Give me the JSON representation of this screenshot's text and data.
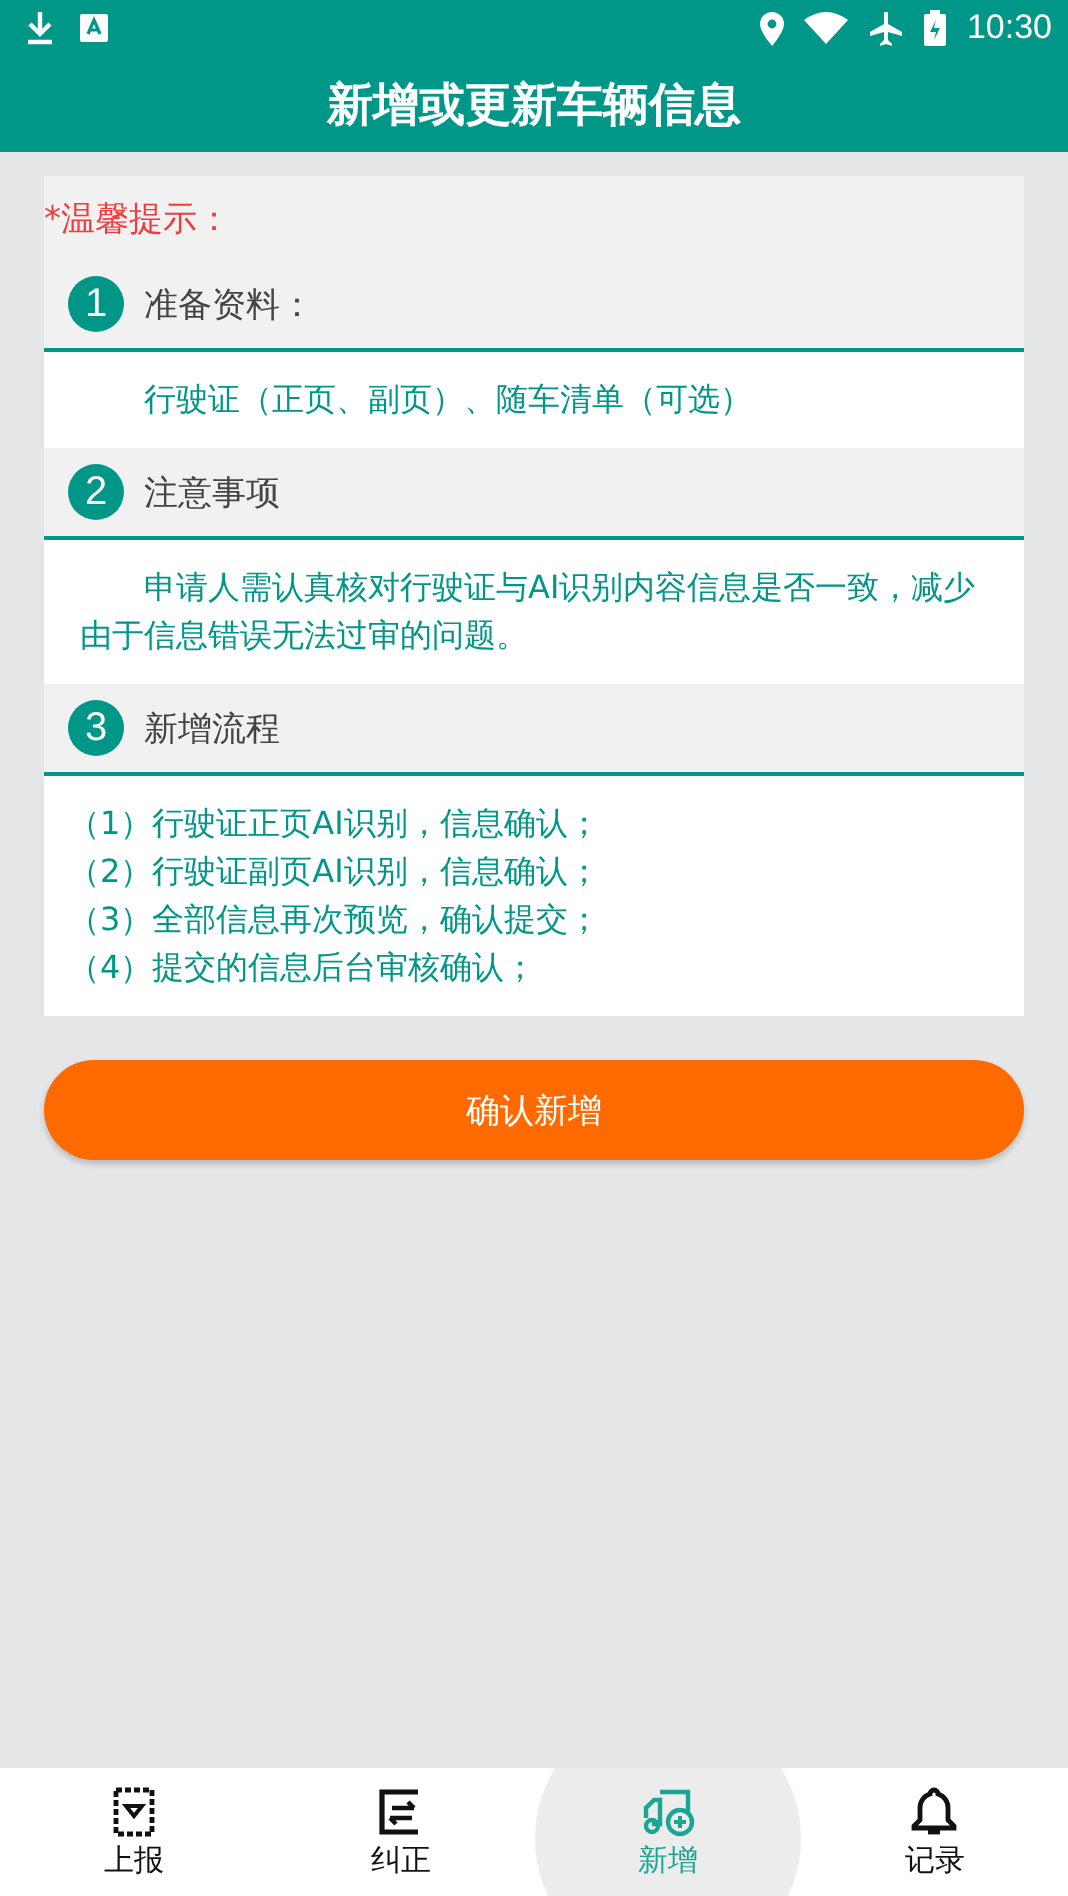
{
  "status_bar": {
    "time": "10:30"
  },
  "title": "新增或更新车辆信息",
  "tip": "*温馨提示：",
  "sections": [
    {
      "number": "1",
      "heading": "准备资料：",
      "kind": "paragraph",
      "lines": [
        "行驶证（正页、副页）、随车清单（可选）"
      ]
    },
    {
      "number": "2",
      "heading": "注意事项",
      "kind": "paragraph",
      "lines": [
        "申请人需认真核对行驶证与AI识别内容信息是否一致，减少由于信息错误无法过审的问题。"
      ]
    },
    {
      "number": "3",
      "heading": "新增流程",
      "kind": "list",
      "lines": [
        "（1）行驶证正页AI识别，信息确认；",
        "（2）行驶证副页AI识别，信息确认；",
        "（3）全部信息再次预览，确认提交；",
        "（4）提交的信息后台审核确认；"
      ]
    }
  ],
  "confirm_button": "确认新增",
  "nav": [
    {
      "label": "上报",
      "selected": false
    },
    {
      "label": "纠正",
      "selected": false
    },
    {
      "label": "新增",
      "selected": true
    },
    {
      "label": "记录",
      "selected": false
    }
  ]
}
